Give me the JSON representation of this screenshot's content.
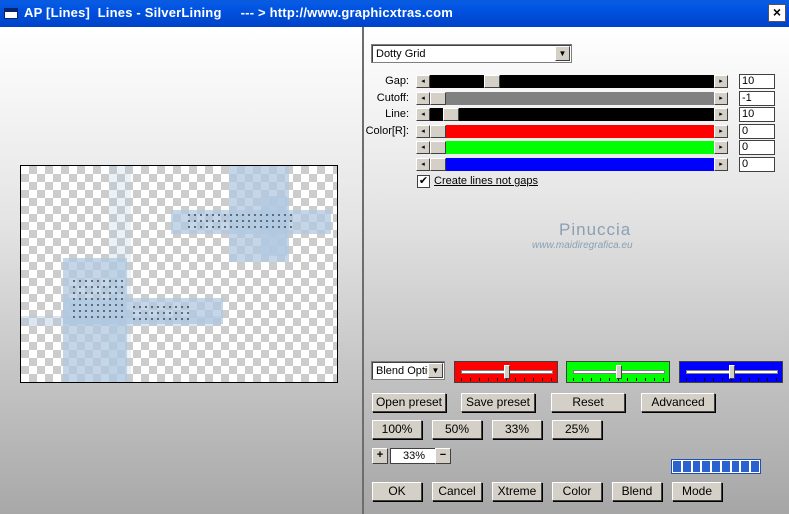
{
  "window": {
    "title": "AP [Lines]  Lines - SilverLining     --- > http://www.graphicxtras.com",
    "close_glyph": "×"
  },
  "effect_select": {
    "value": "Dotty Grid"
  },
  "sliders": [
    {
      "id": "gap",
      "label": "Gap:",
      "value": "10",
      "level": 0.2,
      "color": "#000000"
    },
    {
      "id": "cutoff",
      "label": "Cutoff:",
      "value": "-1",
      "level": 0.0,
      "color": "#808080"
    },
    {
      "id": "line",
      "label": "Line:",
      "value": "10",
      "level": 0.05,
      "color": "#000000"
    },
    {
      "id": "red",
      "label": "Color[R]:",
      "value": "0",
      "level": 0.0,
      "color": "#ff0000"
    },
    {
      "id": "green",
      "label": "",
      "value": "0",
      "level": 0.0,
      "color": "#00ff00"
    },
    {
      "id": "blue",
      "label": "",
      "value": "0",
      "level": 0.0,
      "color": "#0000ff"
    }
  ],
  "checkbox": {
    "label": "Create lines not gaps",
    "checked": true,
    "mark": "✔"
  },
  "watermark": {
    "line1": "Pinuccia",
    "line2": "www.maidiregrafica.eu"
  },
  "blend_select": {
    "value": "Blend Options"
  },
  "color_boxes": [
    {
      "name": "red",
      "color": "#ff0000",
      "level": 0.5
    },
    {
      "name": "green",
      "color": "#00ff00",
      "level": 0.5
    },
    {
      "name": "blue",
      "color": "#0000ff",
      "level": 0.5
    }
  ],
  "buttons": {
    "open_preset": "Open preset",
    "save_preset": "Save preset",
    "reset": "Reset",
    "advanced": "Advanced",
    "zoom_100": "100%",
    "zoom_50": "50%",
    "zoom_33": "33%",
    "zoom_25": "25%",
    "zoom_plus": "+",
    "zoom_minus": "−",
    "ok": "OK",
    "cancel": "Cancel",
    "xtreme": "Xtreme",
    "color": "Color",
    "blend": "Blend",
    "mode": "Mode"
  },
  "zoom": {
    "value": "33%"
  },
  "progress": {
    "filled_segments": 9,
    "total_segments": 9
  },
  "arrows": {
    "left": "◂",
    "right": "▸",
    "down": "▼"
  },
  "colors": {
    "title_bar": "#0054e3",
    "accent_blue": "#2a62d0"
  }
}
